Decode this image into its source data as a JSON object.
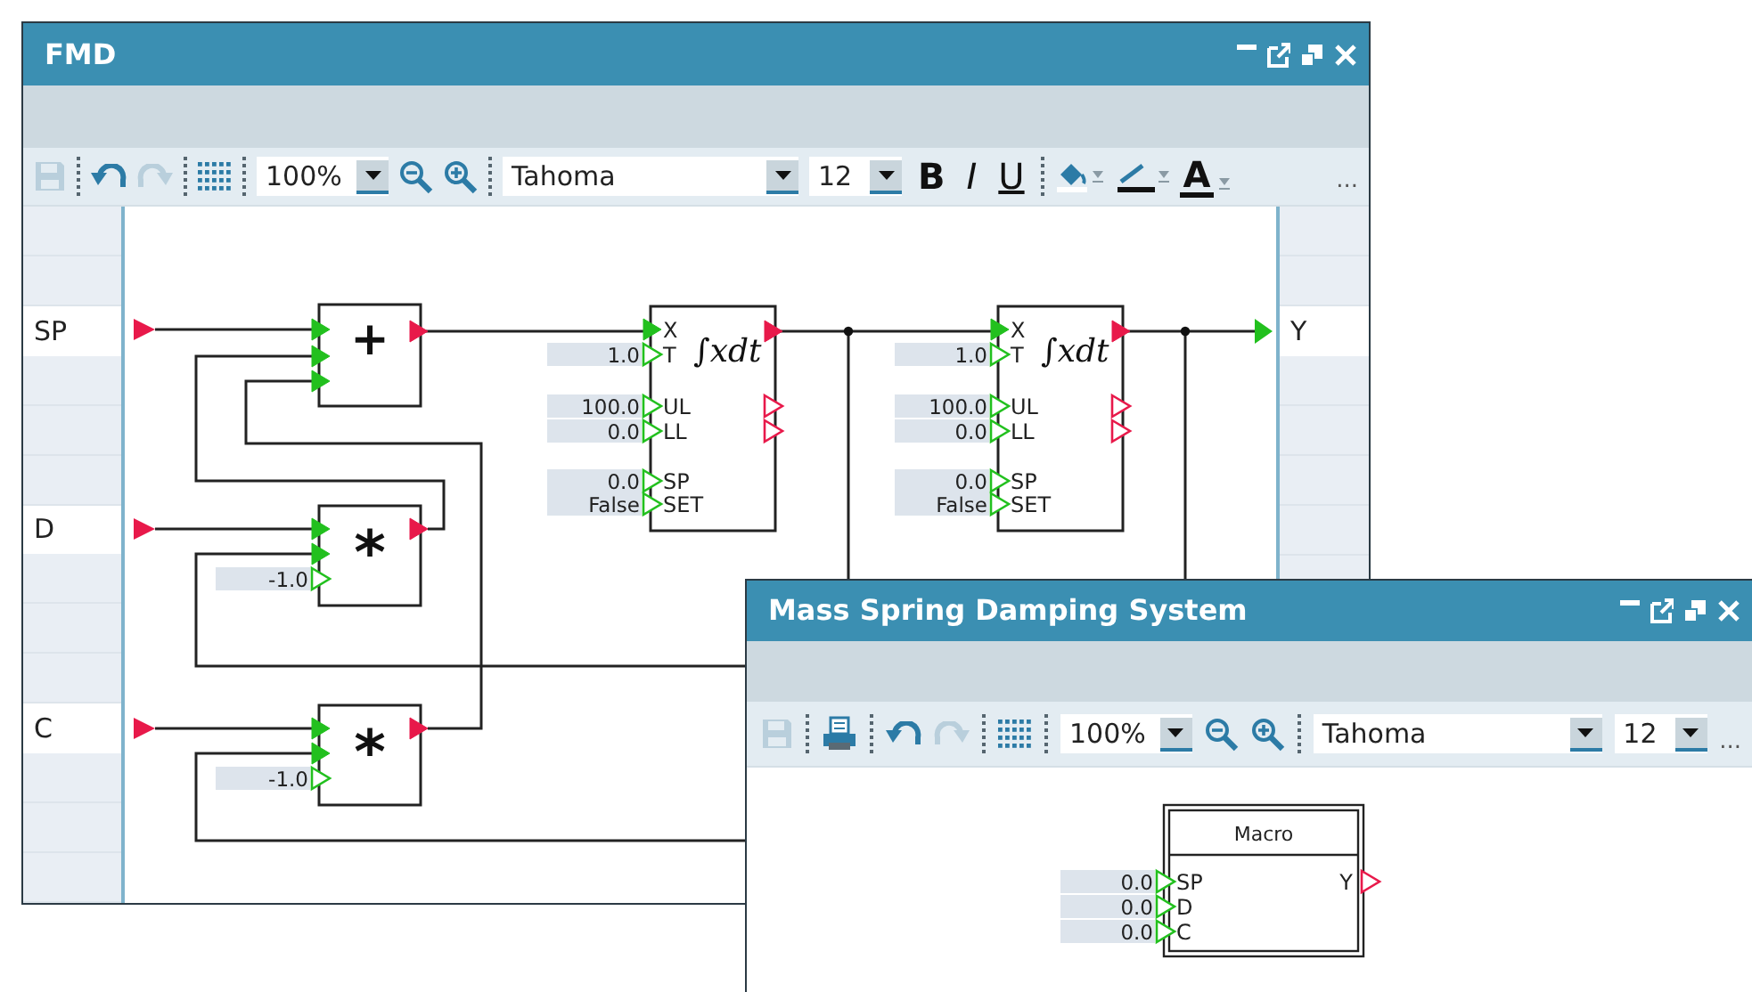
{
  "windows": [
    {
      "title": "FMD",
      "toolbar": [
        {
          "kind": "save",
          "disabled": true
        },
        {
          "kind": "separator"
        },
        {
          "kind": "undo",
          "disabled": false
        },
        {
          "kind": "redo",
          "disabled": true
        },
        {
          "kind": "separator"
        },
        {
          "kind": "grid"
        },
        {
          "kind": "separator"
        },
        {
          "kind": "zoom",
          "value": "100%"
        },
        {
          "kind": "zoomout"
        },
        {
          "kind": "zoomin"
        },
        {
          "kind": "separator"
        },
        {
          "kind": "font",
          "value": "Tahoma"
        },
        {
          "kind": "size",
          "value": "12"
        },
        {
          "kind": "bold",
          "label": "B"
        },
        {
          "kind": "italic",
          "label": "I"
        },
        {
          "kind": "underline",
          "label": "U"
        },
        {
          "kind": "separator"
        },
        {
          "kind": "fill"
        },
        {
          "kind": "line"
        },
        {
          "kind": "color",
          "label": "A"
        },
        {
          "kind": "more",
          "label": "..."
        }
      ],
      "inputs": [
        {
          "label": "SP"
        },
        {
          "label": "D"
        },
        {
          "label": "C"
        }
      ],
      "outputs": [
        {
          "label": "Y"
        }
      ],
      "blocks": [
        {
          "kind": "sum",
          "symbol": "+",
          "inputs": [
            {
              "connected": true
            },
            {
              "connected": true
            },
            {
              "connected": true
            }
          ],
          "outputs": [
            {
              "connected": true
            }
          ]
        },
        {
          "kind": "product",
          "symbol": "*",
          "inputs": [
            {
              "connected": true
            },
            {
              "connected": true
            },
            {
              "connected": false,
              "value": "-1.0"
            }
          ],
          "outputs": [
            {
              "connected": true
            }
          ]
        },
        {
          "kind": "product",
          "symbol": "*",
          "inputs": [
            {
              "connected": true
            },
            {
              "connected": true
            },
            {
              "connected": false,
              "value": "-1.0"
            }
          ],
          "outputs": [
            {
              "connected": true
            }
          ]
        },
        {
          "kind": "integrator",
          "symbol": "∫xdt",
          "inputs": [
            {
              "label": "X",
              "connected": true
            },
            {
              "label": "T",
              "connected": false,
              "value": "1.0"
            },
            {
              "label": "UL",
              "connected": false,
              "value": "100.0"
            },
            {
              "label": "LL",
              "connected": false,
              "value": "0.0"
            },
            {
              "label": "SP",
              "connected": false,
              "value": "0.0"
            },
            {
              "label": "SET",
              "connected": false,
              "value": "False"
            }
          ],
          "outputs": [
            {
              "connected": true
            },
            {
              "connected": false
            },
            {
              "connected": false
            }
          ]
        },
        {
          "kind": "integrator",
          "symbol": "∫xdt",
          "inputs": [
            {
              "label": "X",
              "connected": true
            },
            {
              "label": "T",
              "connected": false,
              "value": "1.0"
            },
            {
              "label": "UL",
              "connected": false,
              "value": "100.0"
            },
            {
              "label": "LL",
              "connected": false,
              "value": "0.0"
            },
            {
              "label": "SP",
              "connected": false,
              "value": "0.0"
            },
            {
              "label": "SET",
              "connected": false,
              "value": "False"
            }
          ],
          "outputs": [
            {
              "connected": true
            },
            {
              "connected": false
            },
            {
              "connected": false
            }
          ]
        }
      ]
    },
    {
      "title": "Mass Spring Damping System",
      "toolbar": [
        {
          "kind": "save",
          "disabled": true
        },
        {
          "kind": "separator"
        },
        {
          "kind": "print"
        },
        {
          "kind": "separator"
        },
        {
          "kind": "undo",
          "disabled": false
        },
        {
          "kind": "redo",
          "disabled": true
        },
        {
          "kind": "separator"
        },
        {
          "kind": "grid"
        },
        {
          "kind": "separator"
        },
        {
          "kind": "zoom",
          "value": "100%"
        },
        {
          "kind": "zoomout"
        },
        {
          "kind": "zoomin"
        },
        {
          "kind": "separator"
        },
        {
          "kind": "font",
          "value": "Tahoma"
        },
        {
          "kind": "size",
          "value": "12"
        },
        {
          "kind": "more",
          "label": "..."
        }
      ],
      "blocks": [
        {
          "kind": "macro",
          "symbol": "Macro",
          "inputs": [
            {
              "label": "SP",
              "connected": false,
              "value": "0.0"
            },
            {
              "label": "D",
              "connected": false,
              "value": "0.0"
            },
            {
              "label": "C",
              "connected": false,
              "value": "0.0"
            }
          ],
          "outputs": [
            {
              "label": "Y",
              "connected": false
            }
          ]
        }
      ]
    }
  ]
}
